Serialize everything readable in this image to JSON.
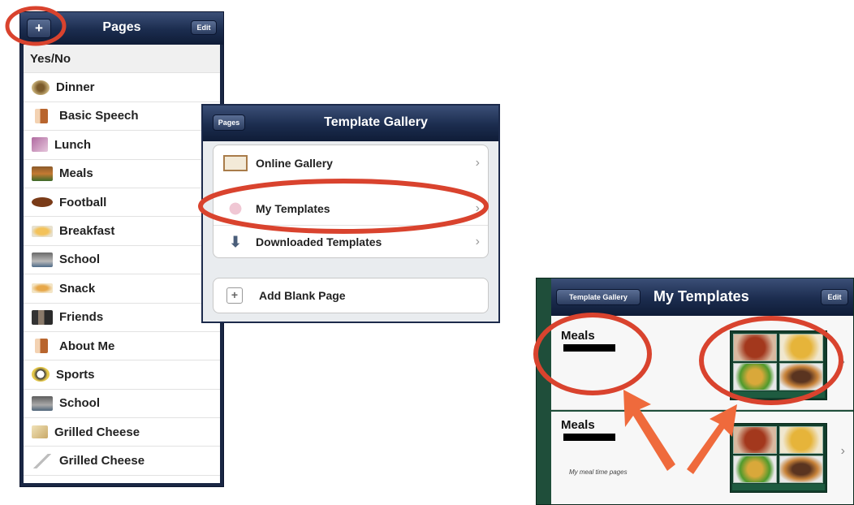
{
  "pages_panel": {
    "title": "Pages",
    "add_label": "+",
    "edit_label": "Edit",
    "items": [
      {
        "label": "Yes/No"
      },
      {
        "label": "Dinner"
      },
      {
        "label": "Basic Speech"
      },
      {
        "label": "Lunch"
      },
      {
        "label": "Meals"
      },
      {
        "label": "Football"
      },
      {
        "label": "Breakfast"
      },
      {
        "label": "School"
      },
      {
        "label": "Snack"
      },
      {
        "label": "Friends"
      },
      {
        "label": "About Me"
      },
      {
        "label": "Sports"
      },
      {
        "label": "School"
      },
      {
        "label": "Grilled Cheese"
      },
      {
        "label": "Grilled Cheese"
      }
    ]
  },
  "template_gallery": {
    "title": "Template Gallery",
    "back_label": "Pages",
    "items": [
      {
        "label": "Online Gallery"
      },
      {
        "label": "My Templates"
      },
      {
        "label": "Downloaded Templates"
      }
    ],
    "add_blank_label": "Add Blank Page"
  },
  "my_templates": {
    "title": "My Templates",
    "back_label": "Template Gallery",
    "edit_label": "Edit",
    "templates": [
      {
        "name": "Meals",
        "description": ""
      },
      {
        "name": "Meals",
        "description": "My meal time pages"
      }
    ]
  },
  "colors": {
    "navbar": "#1b2c4e",
    "highlight_red": "#d9432e",
    "arrow_orange": "#ef6a3c",
    "template_bg": "#1f4e3a"
  }
}
